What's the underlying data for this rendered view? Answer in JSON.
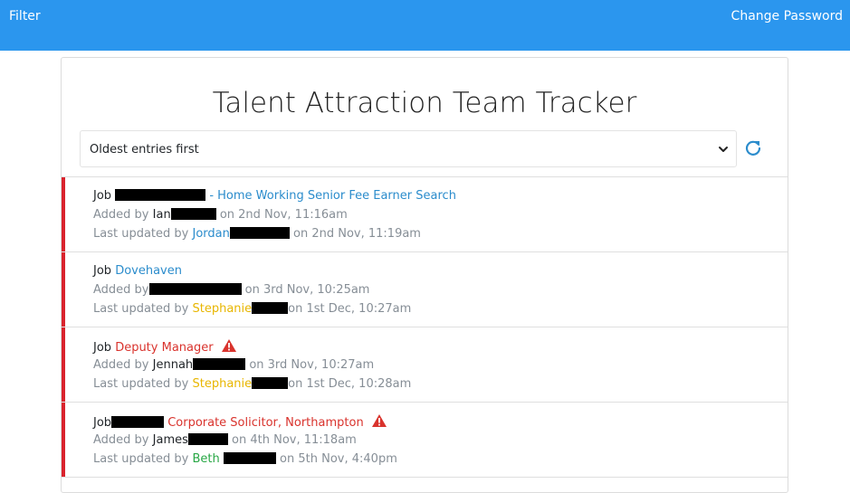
{
  "navbar": {
    "filter_label": "Filter",
    "change_password_label": "Change Password",
    "background_color": "#2b96ee"
  },
  "header": {
    "title": "Talent Attraction Team Tracker",
    "sort_select": {
      "selected": "Oldest entries first"
    },
    "refresh_icon": "refresh-icon"
  },
  "entries": [
    {
      "job_prefix": "Job",
      "job_title": "- Home Working Senior Fee Earner Search",
      "added_by_prefix": "Added by",
      "added_by_name": "Ian",
      "added_on": "on 2nd Nov, 11:16am",
      "updated_by_prefix": "Last updated by",
      "updated_by_name": "Jordan",
      "updated_on": "on 2nd Nov, 11:19am",
      "status_color": "#d9232d"
    },
    {
      "job_prefix": "Job",
      "job_title": "Dovehaven",
      "added_by_prefix": "Added by",
      "added_by_name": "",
      "added_on": "on 3rd Nov, 10:25am",
      "updated_by_prefix": "Last updated by",
      "updated_by_name": "Stephanie",
      "updated_on": "on 1st Dec, 10:27am",
      "status_color": "#d9232d"
    },
    {
      "job_prefix": "Job",
      "job_title": "Deputy Manager",
      "warning": true,
      "added_by_prefix": "Added by",
      "added_by_name": "Jennah",
      "added_on": "on 3rd Nov, 10:27am",
      "updated_by_prefix": "Last updated by",
      "updated_by_name": "Stephanie",
      "updated_on": "on 1st Dec, 10:28am",
      "status_color": "#d9232d"
    },
    {
      "job_prefix": "Job",
      "job_title": "Corporate Solicitor, Northampton",
      "warning": true,
      "added_by_prefix": "Added by",
      "added_by_name": "James",
      "added_on": "on 4th Nov, 11:18am",
      "updated_by_prefix": "Last updated by",
      "updated_by_name": "Beth",
      "updated_on": "on 5th Nov, 4:40pm",
      "status_color": "#d9232d"
    }
  ]
}
